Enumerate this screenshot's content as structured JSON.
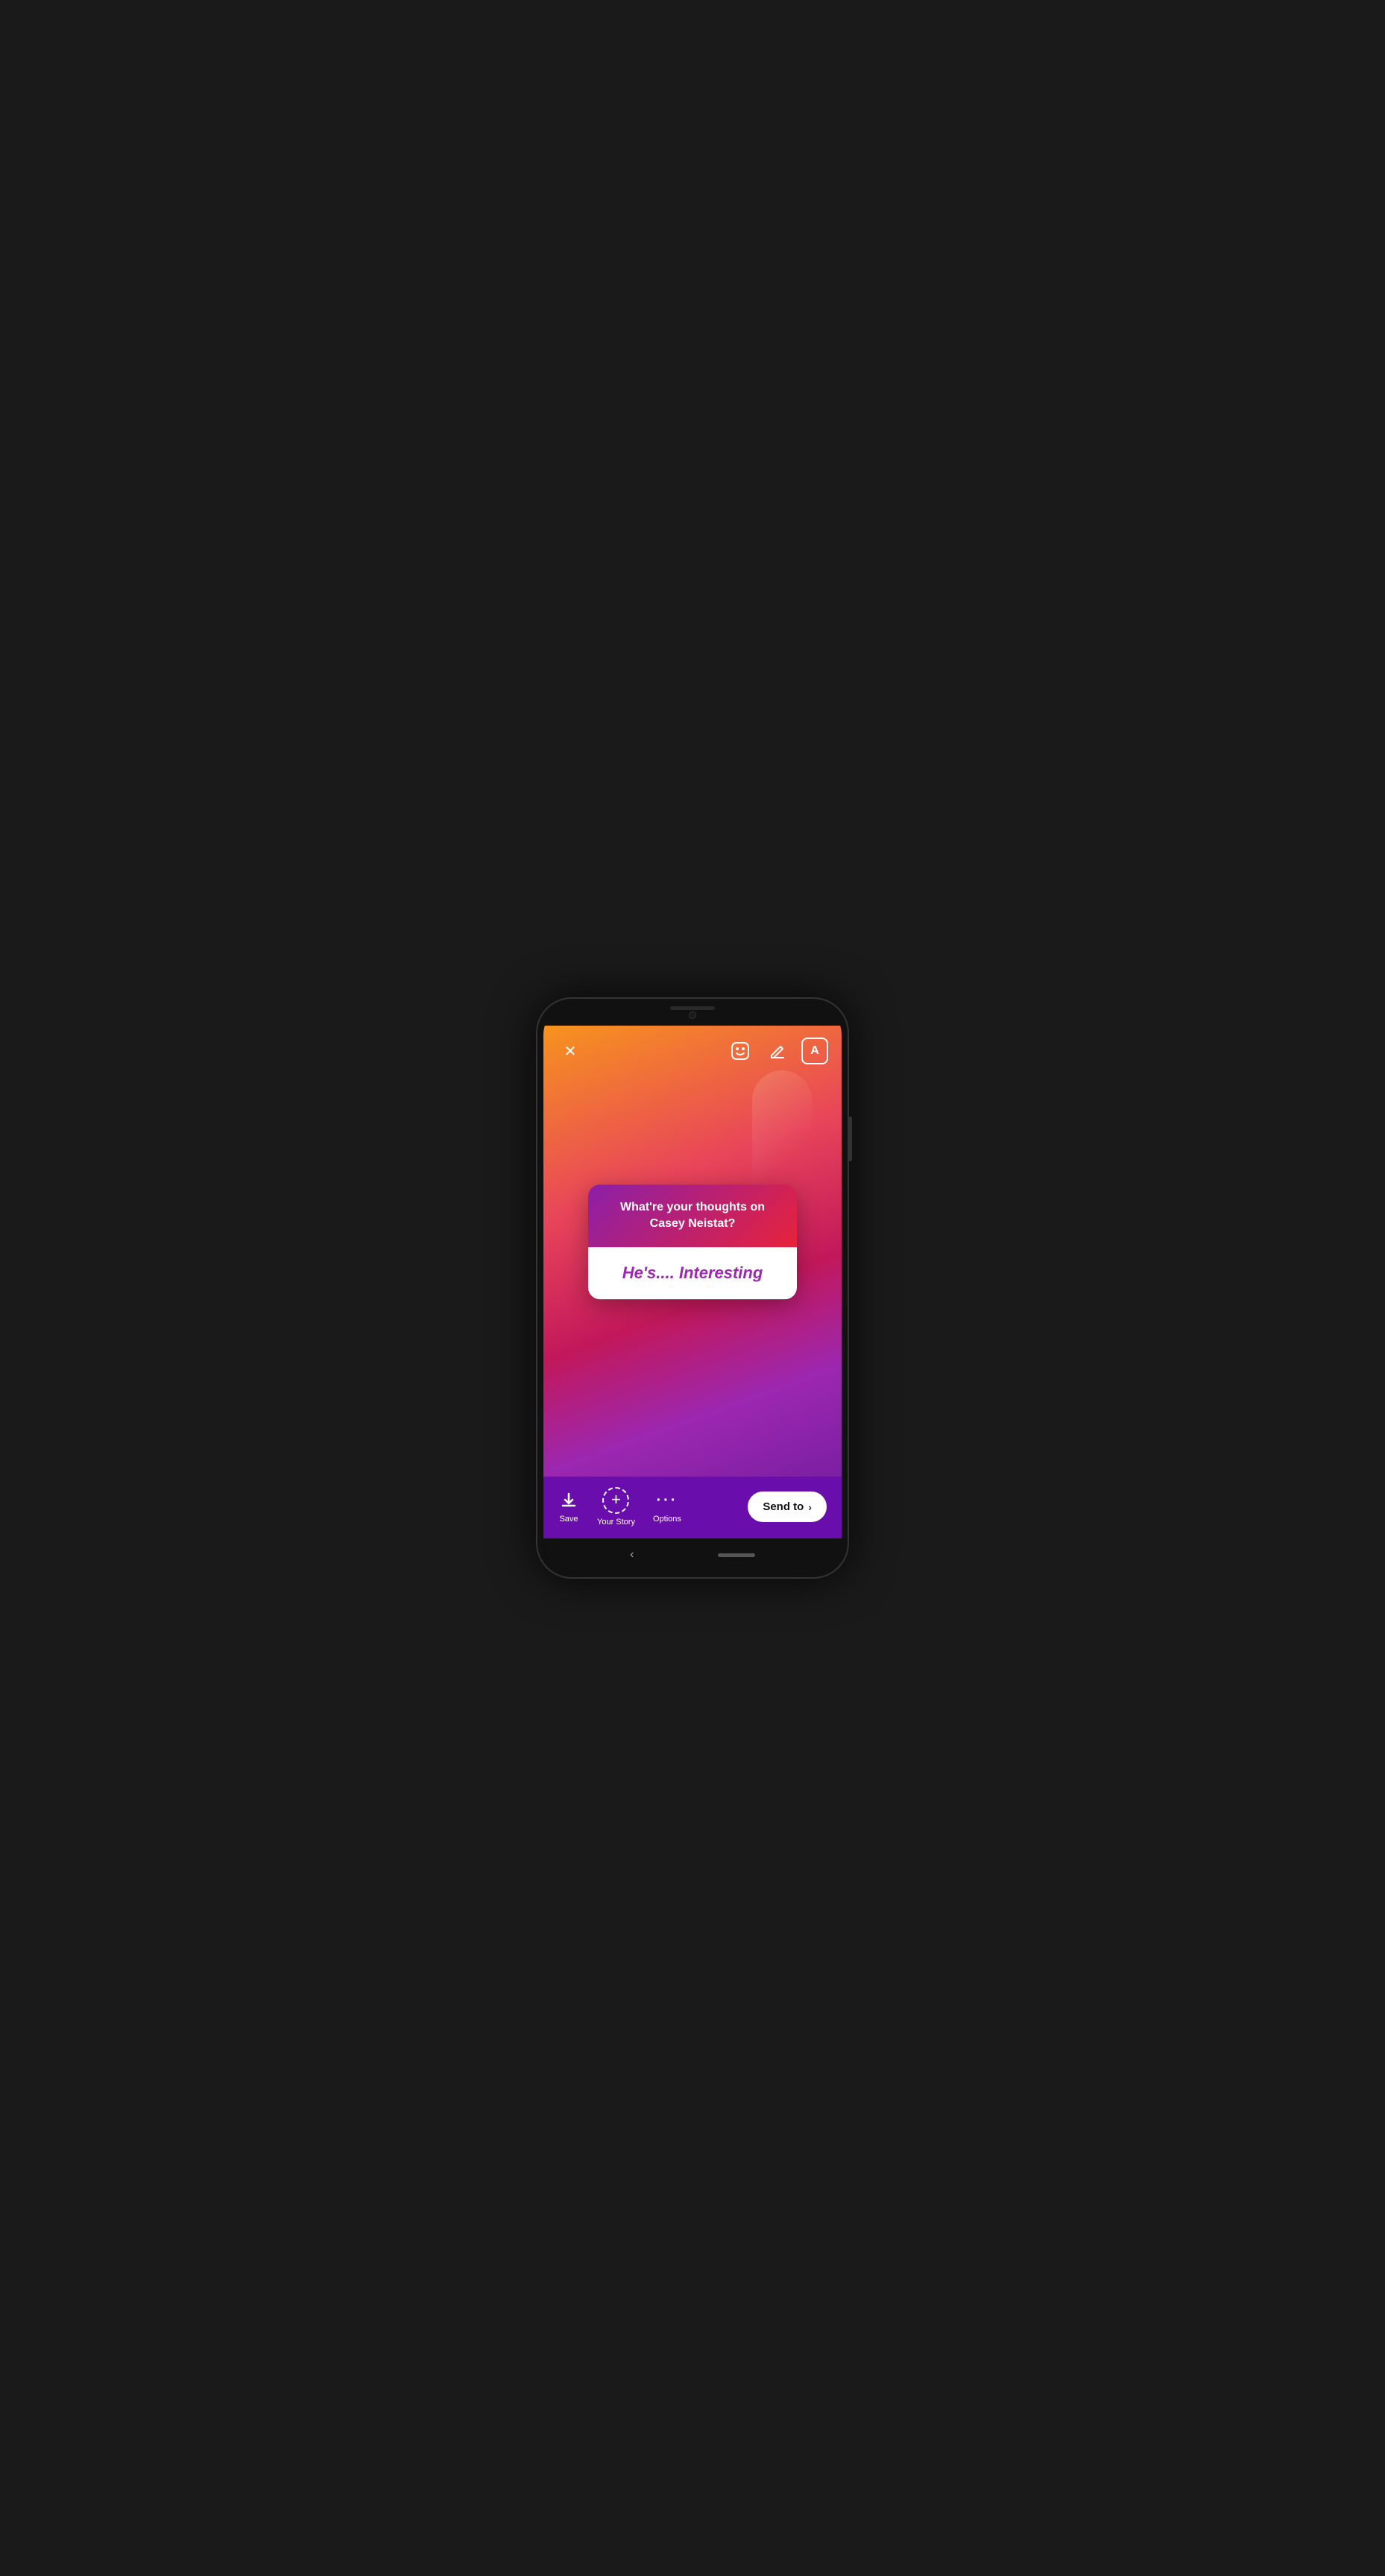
{
  "phone": {
    "speaker": "speaker",
    "camera": "camera"
  },
  "toolbar": {
    "close_label": "✕",
    "sticker_label": "sticker",
    "draw_label": "draw",
    "text_label": "A"
  },
  "question_card": {
    "question": "What're your thoughts on Casey Neistat?",
    "answer": "He's.... Interesting"
  },
  "bottom_bar": {
    "save_label": "Save",
    "your_story_label": "Your Story",
    "options_label": "Options",
    "send_to_label": "Send to"
  },
  "colors": {
    "gradient_top": "#f7931e",
    "gradient_mid": "#e8455a",
    "gradient_bottom": "#9c27b0",
    "bottom_bar_bg": "#6a0dad",
    "card_header_left": "#8b1fa9",
    "card_header_right": "#e8223a",
    "answer_color": "#9c27b0"
  }
}
